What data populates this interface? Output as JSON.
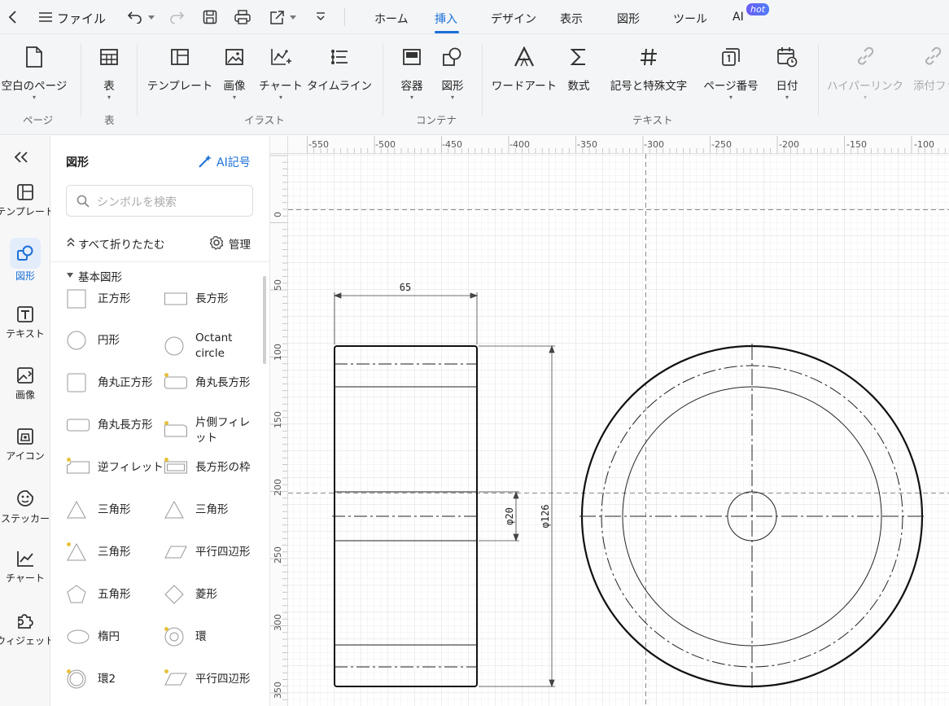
{
  "topbar": {
    "file": "ファイル",
    "tabs": [
      {
        "label": "ホーム",
        "active": false
      },
      {
        "label": "挿入",
        "active": true
      },
      {
        "label": "デザイン",
        "active": false
      },
      {
        "label": "表示",
        "active": false
      },
      {
        "label": "図形",
        "active": false
      },
      {
        "label": "ツール",
        "active": false
      },
      {
        "label": "AI",
        "active": false
      }
    ],
    "ai_badge": "hot"
  },
  "ribbon": {
    "buttons": [
      {
        "id": "blank-page",
        "label": "空白のページ",
        "icon": "blank-page-icon"
      },
      {
        "id": "table",
        "label": "表",
        "icon": "table-icon"
      },
      {
        "id": "template",
        "label": "テンプレート",
        "icon": "template-icon"
      },
      {
        "id": "image",
        "label": "画像",
        "icon": "image-icon"
      },
      {
        "id": "chart",
        "label": "チャート",
        "icon": "chart-icon"
      },
      {
        "id": "timeline",
        "label": "タイムライン",
        "icon": "timeline-icon"
      },
      {
        "id": "container",
        "label": "容器",
        "icon": "container-icon"
      },
      {
        "id": "shapes",
        "label": "図形",
        "icon": "shapes-icon"
      },
      {
        "id": "wordart",
        "label": "ワードアート",
        "icon": "wordart-icon"
      },
      {
        "id": "formula",
        "label": "数式",
        "icon": "sigma-icon"
      },
      {
        "id": "symbols",
        "label": "記号と特殊文字",
        "icon": "hash-icon"
      },
      {
        "id": "page-number",
        "label": "ページ番号",
        "icon": "page-number-icon"
      },
      {
        "id": "date",
        "label": "日付",
        "icon": "calendar-icon"
      },
      {
        "id": "hyperlink",
        "label": "ハイパーリンク",
        "icon": "link-icon",
        "disabled": true
      },
      {
        "id": "attachment",
        "label": "添付ファ",
        "icon": "paperclip-icon",
        "disabled": true
      }
    ],
    "groups": [
      "ページ",
      "表",
      "イラスト",
      "コンテナ",
      "テキスト"
    ]
  },
  "leftnav": [
    {
      "label": "テンプレート",
      "icon": "template-icon",
      "active": false
    },
    {
      "label": "図形",
      "icon": "shapes-icon",
      "active": true
    },
    {
      "label": "テキスト",
      "icon": "text-icon",
      "active": false
    },
    {
      "label": "画像",
      "icon": "image-icon",
      "active": false
    },
    {
      "label": "アイコン",
      "icon": "icon-library-icon",
      "active": false
    },
    {
      "label": "ステッカー",
      "icon": "sticker-icon",
      "active": false
    },
    {
      "label": "チャート",
      "icon": "chart-icon",
      "active": false
    },
    {
      "label": "ウィジェット",
      "icon": "widget-icon",
      "active": false
    }
  ],
  "panel": {
    "title": "図形",
    "ai_symbol": "AI記号",
    "search_placeholder": "シンボルを検索",
    "collapse_all": "すべて折りたたむ",
    "manage": "管理",
    "category": "基本図形",
    "shapes": [
      [
        "正方形",
        "長方形"
      ],
      [
        "円形",
        "Octant circle"
      ],
      [
        "角丸正方形",
        "角丸長方形"
      ],
      [
        "角丸長方形",
        "片側フィレット"
      ],
      [
        "逆フィレット",
        "長方形の枠"
      ],
      [
        "三角形",
        "三角形"
      ],
      [
        "三角形",
        "平行四辺形"
      ],
      [
        "五角形",
        "菱形"
      ],
      [
        "楕円",
        "環"
      ],
      [
        "環2",
        "平行四辺形"
      ]
    ]
  },
  "canvas": {
    "ruler_top": [
      "-550",
      "-500",
      "-450",
      "-400",
      "-350",
      "-300",
      "-250",
      "-200",
      "-150",
      "-100"
    ],
    "ruler_left": [
      "0",
      "50",
      "100",
      "150",
      "200",
      "250",
      "300",
      "350"
    ],
    "dimensions": {
      "width": "65",
      "inner": "φ20",
      "outer": "φ126"
    }
  }
}
